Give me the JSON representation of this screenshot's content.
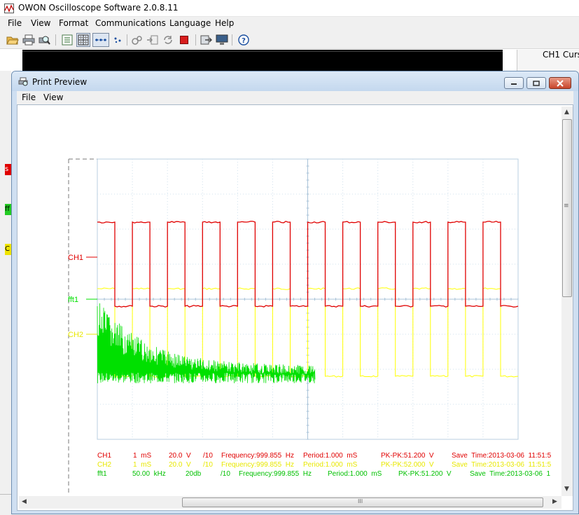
{
  "app": {
    "title": "OWON Oscilloscope Software 2.0.8.11",
    "menu": [
      "File",
      "View",
      "Format",
      "Communications",
      "Language",
      "Help"
    ],
    "right_panel_label": "CH1 Curs",
    "left_marks": [
      "s",
      "ff",
      "C"
    ]
  },
  "print_preview": {
    "title": "Print Preview",
    "menu": [
      "File",
      "View"
    ],
    "hscroll_grip": "III",
    "vscroll_grip": "≡"
  },
  "chart_data": {
    "type": "line",
    "title": "",
    "xlabel": "",
    "ylabel": "",
    "grid": true,
    "x_divisions": 12,
    "y_divisions": 8,
    "channel_markers": [
      "CH1",
      "fft1",
      "CH2"
    ],
    "series": [
      {
        "name": "CH1",
        "color": "#e00000",
        "kind": "square wave",
        "period_divisions": 1,
        "duty": 0.5,
        "high_div": 6.2,
        "low_div": 3.8
      },
      {
        "name": "CH2",
        "color": "#ffff00",
        "kind": "square wave",
        "period_divisions": 1,
        "duty": 0.5,
        "high_div": 4.3,
        "low_div": 1.8
      },
      {
        "name": "fft1",
        "color": "#00e000",
        "kind": "fft noise",
        "x_end_div": 6.2,
        "envelope_top_start_div": 4.0,
        "envelope_top_end_div": 2.1,
        "floor_div": 1.6
      }
    ]
  },
  "info_rows": [
    {
      "color": "#e00000",
      "cells": [
        "CH1",
        "1  mS",
        "20.0  V",
        "/10",
        "Frequency:999.855  Hz",
        "Period:1.000  mS",
        "PK-PK:51.200  V",
        "Save  Time:2013-03-06  11:51:5"
      ]
    },
    {
      "color": "#e8e800",
      "cells": [
        "CH2",
        "1  mS",
        "20.0  V",
        "/10",
        "Frequency:999.855  Hz",
        "Period:1.000  mS",
        "PK-PK:52.000  V",
        "Save  Time:2013-03-06  11:51:5"
      ]
    },
    {
      "color": "#00c000",
      "cells": [
        "fft1",
        "50.00  kHz",
        "20db",
        "/10",
        "Frequency:999.855  Hz",
        "Period:1.000  mS",
        "PK-PK:51.200  V",
        "Save  Time:2013-03-06  1"
      ]
    }
  ]
}
